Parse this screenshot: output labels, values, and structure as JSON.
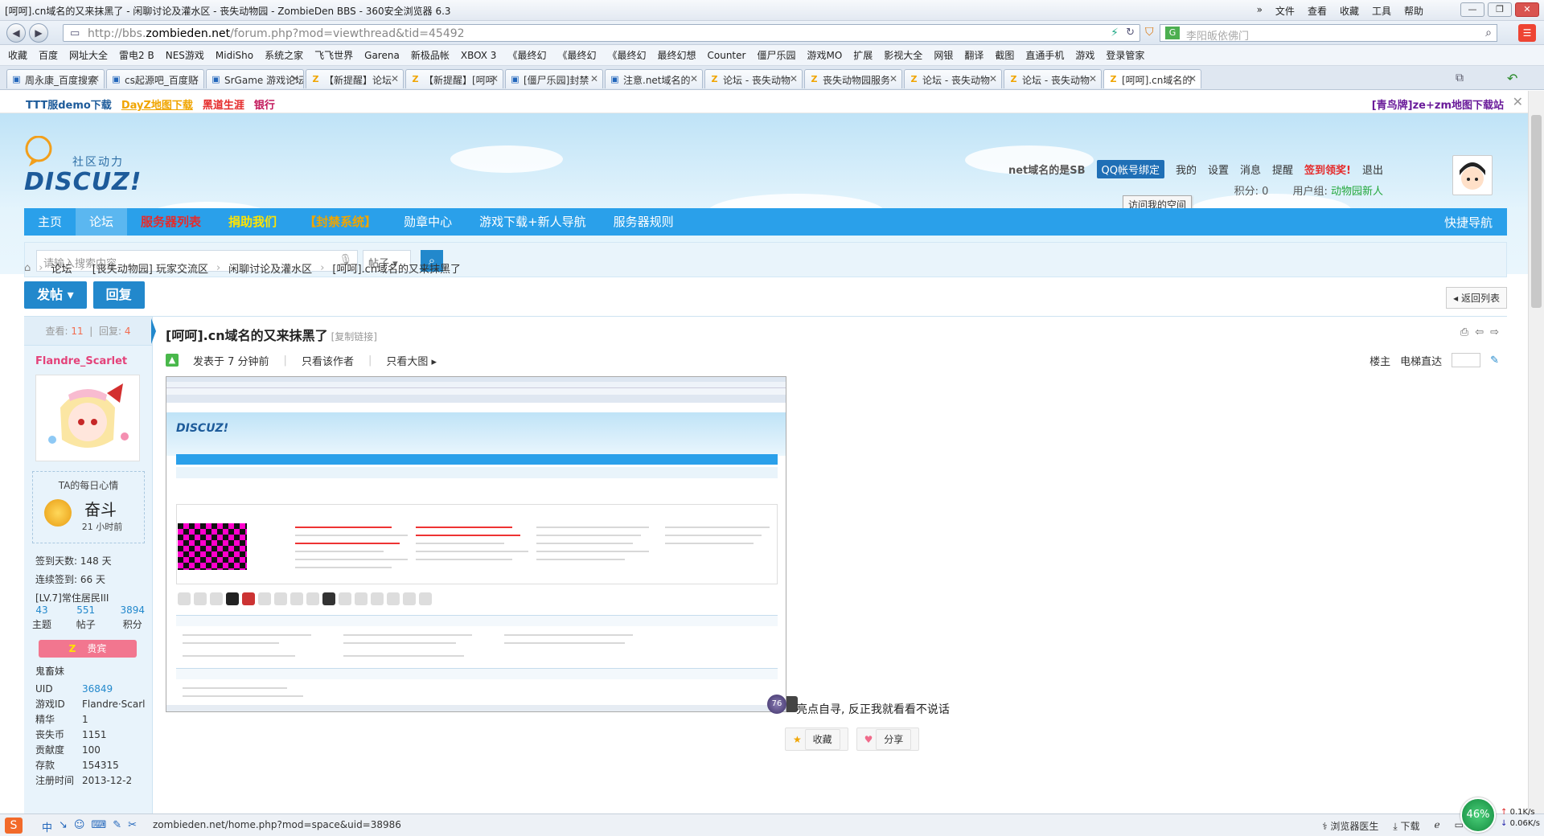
{
  "window": {
    "title": "[呵呵].cn域名的又来抹黑了 - 闲聊讨论及灌水区 - 丧失动物园 - ZombieDen BBS - 360安全浏览器 6.3",
    "menus": [
      "»",
      "文件",
      "查看",
      "收藏",
      "工具",
      "帮助"
    ],
    "controls": [
      "—",
      "❐",
      "✕"
    ]
  },
  "address": {
    "url_prefix": "http://bbs.",
    "url_host": "zombieden.net",
    "url_rest": "/forum.php?mod=viewthread&tid=45492",
    "search_placeholder": "李阳皈依佛门"
  },
  "bookmarks": [
    "收藏",
    "百度",
    "网址大全",
    "雷电2 B",
    "NES游戏",
    "MidiSho",
    "系统之家",
    "飞飞世界",
    "Garena",
    "新极品帐",
    "XBOX 3",
    "《最终幻",
    "《最终幻",
    "《最终幻",
    "最终幻想",
    "Counter",
    "僵尸乐园",
    "游戏MO",
    "扩展",
    "影视大全",
    "网银",
    "翻译",
    "截图",
    "直通手机",
    "游戏",
    "登录管家"
  ],
  "tabs": [
    {
      "label": "周永康_百度搜索",
      "icon": "▣"
    },
    {
      "label": "cs起源吧_百度贴",
      "icon": "▣"
    },
    {
      "label": "SrGame 游戏论坛",
      "icon": "▣"
    },
    {
      "label": "【新提醒】论坛",
      "icon": "Z"
    },
    {
      "label": "【新提醒】[呵呵",
      "icon": "Z"
    },
    {
      "label": "[僵尸乐园]封禁",
      "icon": "▣"
    },
    {
      "label": "注意.net域名的",
      "icon": "▣"
    },
    {
      "label": "论坛 - 丧失动物",
      "icon": "Z"
    },
    {
      "label": "丧失动物园服务",
      "icon": "Z"
    },
    {
      "label": "论坛 - 丧失动物",
      "icon": "Z"
    },
    {
      "label": "论坛 - 丧失动物",
      "icon": "Z"
    },
    {
      "label": "[呵呵].cn域名的",
      "icon": "Z"
    }
  ],
  "topstrip": {
    "links": [
      "TTT服demo下载",
      "DayZ地图下载",
      "黑道生涯",
      "银行"
    ],
    "right": "[青鸟牌]ze+zm地图下载站"
  },
  "header": {
    "logo_sub": "社区动力",
    "logo_main": "DISCUZ!",
    "username": "net域名的是SB",
    "qq_bind": "QQ帐号绑定",
    "links": [
      "我的",
      "设置",
      "消息",
      "提醒"
    ],
    "sign": "签到领奖!",
    "logout": "退出",
    "score": "积分: 0",
    "group_label": "用户组:",
    "group": "动物园新人",
    "tooltip": "访问我的空间"
  },
  "nav": {
    "items": [
      "主页",
      "论坛",
      "服务器列表",
      "捐助我们",
      "【封禁系统】",
      "勋章中心",
      "游戏下载+新人导航",
      "服务器规则"
    ],
    "right": "快捷导航"
  },
  "search": {
    "placeholder": "请输入搜索内容",
    "type": "帖子"
  },
  "breadcrumb": [
    "论坛",
    "[丧失动物园] 玩家交流区",
    "闲聊讨论及灌水区",
    "[呵呵].cn域名的又来抹黑了"
  ],
  "actions": {
    "post": "发帖",
    "reply": "回复",
    "back": "返回列表"
  },
  "post": {
    "views_label": "查看:",
    "views": "11",
    "replies_label": "回复:",
    "replies": "4",
    "author": "Flandre_Scarlet",
    "mood_title": "TA的每日心情",
    "mood": "奋斗",
    "mood_time": "21 小时前",
    "sign_days": "签到天数: 148 天",
    "streak": "连续签到: 66 天",
    "level": "[LV.7]常住居民III",
    "counts": [
      {
        "n": "43",
        "l": "主题"
      },
      {
        "n": "551",
        "l": "帖子"
      },
      {
        "n": "3894",
        "l": "积分"
      }
    ],
    "badge": "贵宾",
    "ghost": "鬼畜妹",
    "profile": [
      {
        "k": "UID",
        "v": "36849"
      },
      {
        "k": "游戏ID",
        "v": "Flandre·Scarl"
      },
      {
        "k": "精华",
        "v": "1"
      },
      {
        "k": "丧失币",
        "v": "1151"
      },
      {
        "k": "贡献度",
        "v": "100"
      },
      {
        "k": "存款",
        "v": "154315"
      },
      {
        "k": "注册时间",
        "v": "2013-12-2"
      }
    ],
    "title": "[呵呵].cn域名的又来抹黑了",
    "copy_link": "[复制链接]",
    "posted": "发表于 7 分钟前",
    "author_only": "只看该作者",
    "big_image": "只看大图",
    "floor_label": "楼主",
    "elevator": "电梯直达",
    "caption": "亮点自寻, 反正我就看看不说话",
    "ball_value": "76",
    "favorite": "收藏",
    "share": "分享"
  },
  "statusbar": {
    "ime": "S",
    "ime_items": [
      "中",
      "↘",
      "☺",
      "⌨",
      "✎",
      "✂"
    ],
    "url": "zombieden.net/home.php?mod=space&uid=38986",
    "right": [
      "浏览器医生",
      "下载"
    ],
    "net_percent": "46%",
    "up": "0.1K/s",
    "down": "0.06K/s"
  },
  "colors": {
    "nav": "#2aa0ea",
    "accent": "#2288cc",
    "alert": "#e52b2b",
    "author": "#e4427a"
  }
}
